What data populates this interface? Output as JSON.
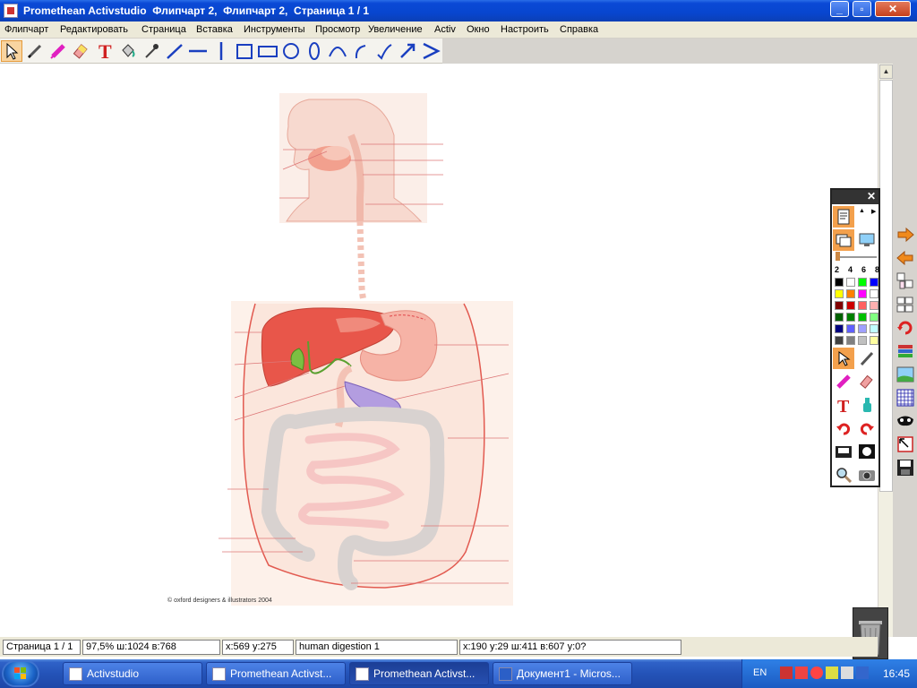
{
  "window": {
    "title": "Promethean Activstudio  Флипчарт 2,  Флипчарт 2,  Страница 1 / 1",
    "minimize": "_",
    "maximize": "▫",
    "close": "✕"
  },
  "menu": [
    "Флипчарт",
    "Редактировать",
    "Страница",
    "Вставка",
    "Инструменты",
    "Просмотр",
    "Увеличение",
    "Activ",
    "Окно",
    "Настроить",
    "Справка"
  ],
  "toolbar": {
    "tools": [
      "select-arrow",
      "pen",
      "highlighter",
      "eraser",
      "text",
      "fill",
      "dropper",
      "line-thin",
      "line-horizontal",
      "line-vertical",
      "rectangle",
      "rectangle-wide",
      "circle",
      "ellipse",
      "arc",
      "curve",
      "check-curve",
      "arrow",
      "chevron"
    ]
  },
  "canvas": {
    "copyright": "© oxford designers & illustrators 2004"
  },
  "panel": {
    "close": "✕",
    "widths": [
      "2",
      "4",
      "6",
      "8"
    ],
    "colors": [
      "#000000",
      "#ffffff",
      "#00ff00",
      "#0000ff",
      "#ffff00",
      "#ff8000",
      "#ff00ff",
      "#ffffff",
      "#800000",
      "#cc0000",
      "#ff6060",
      "#ffb0b0",
      "#006000",
      "#008000",
      "#00c000",
      "#80ff80",
      "#000080",
      "#6060ff",
      "#a0a0ff",
      "#c0ffff",
      "#404040",
      "#808080",
      "#c0c0c0",
      "#ffffa0"
    ]
  },
  "status": {
    "page": "Страница 1 / 1",
    "zoom": "97,5%  ш:1024  в:768",
    "coords": "x:569  y:275",
    "name": "human digestion 1",
    "object": "x:190  y:29  ш:411  в:607  y:0?"
  },
  "taskbar": {
    "tasks": [
      "Activstudio",
      "Promethean Activst...",
      "Promethean Activst...",
      "Документ1 - Micros..."
    ],
    "lang": "EN",
    "time": "16:45"
  }
}
